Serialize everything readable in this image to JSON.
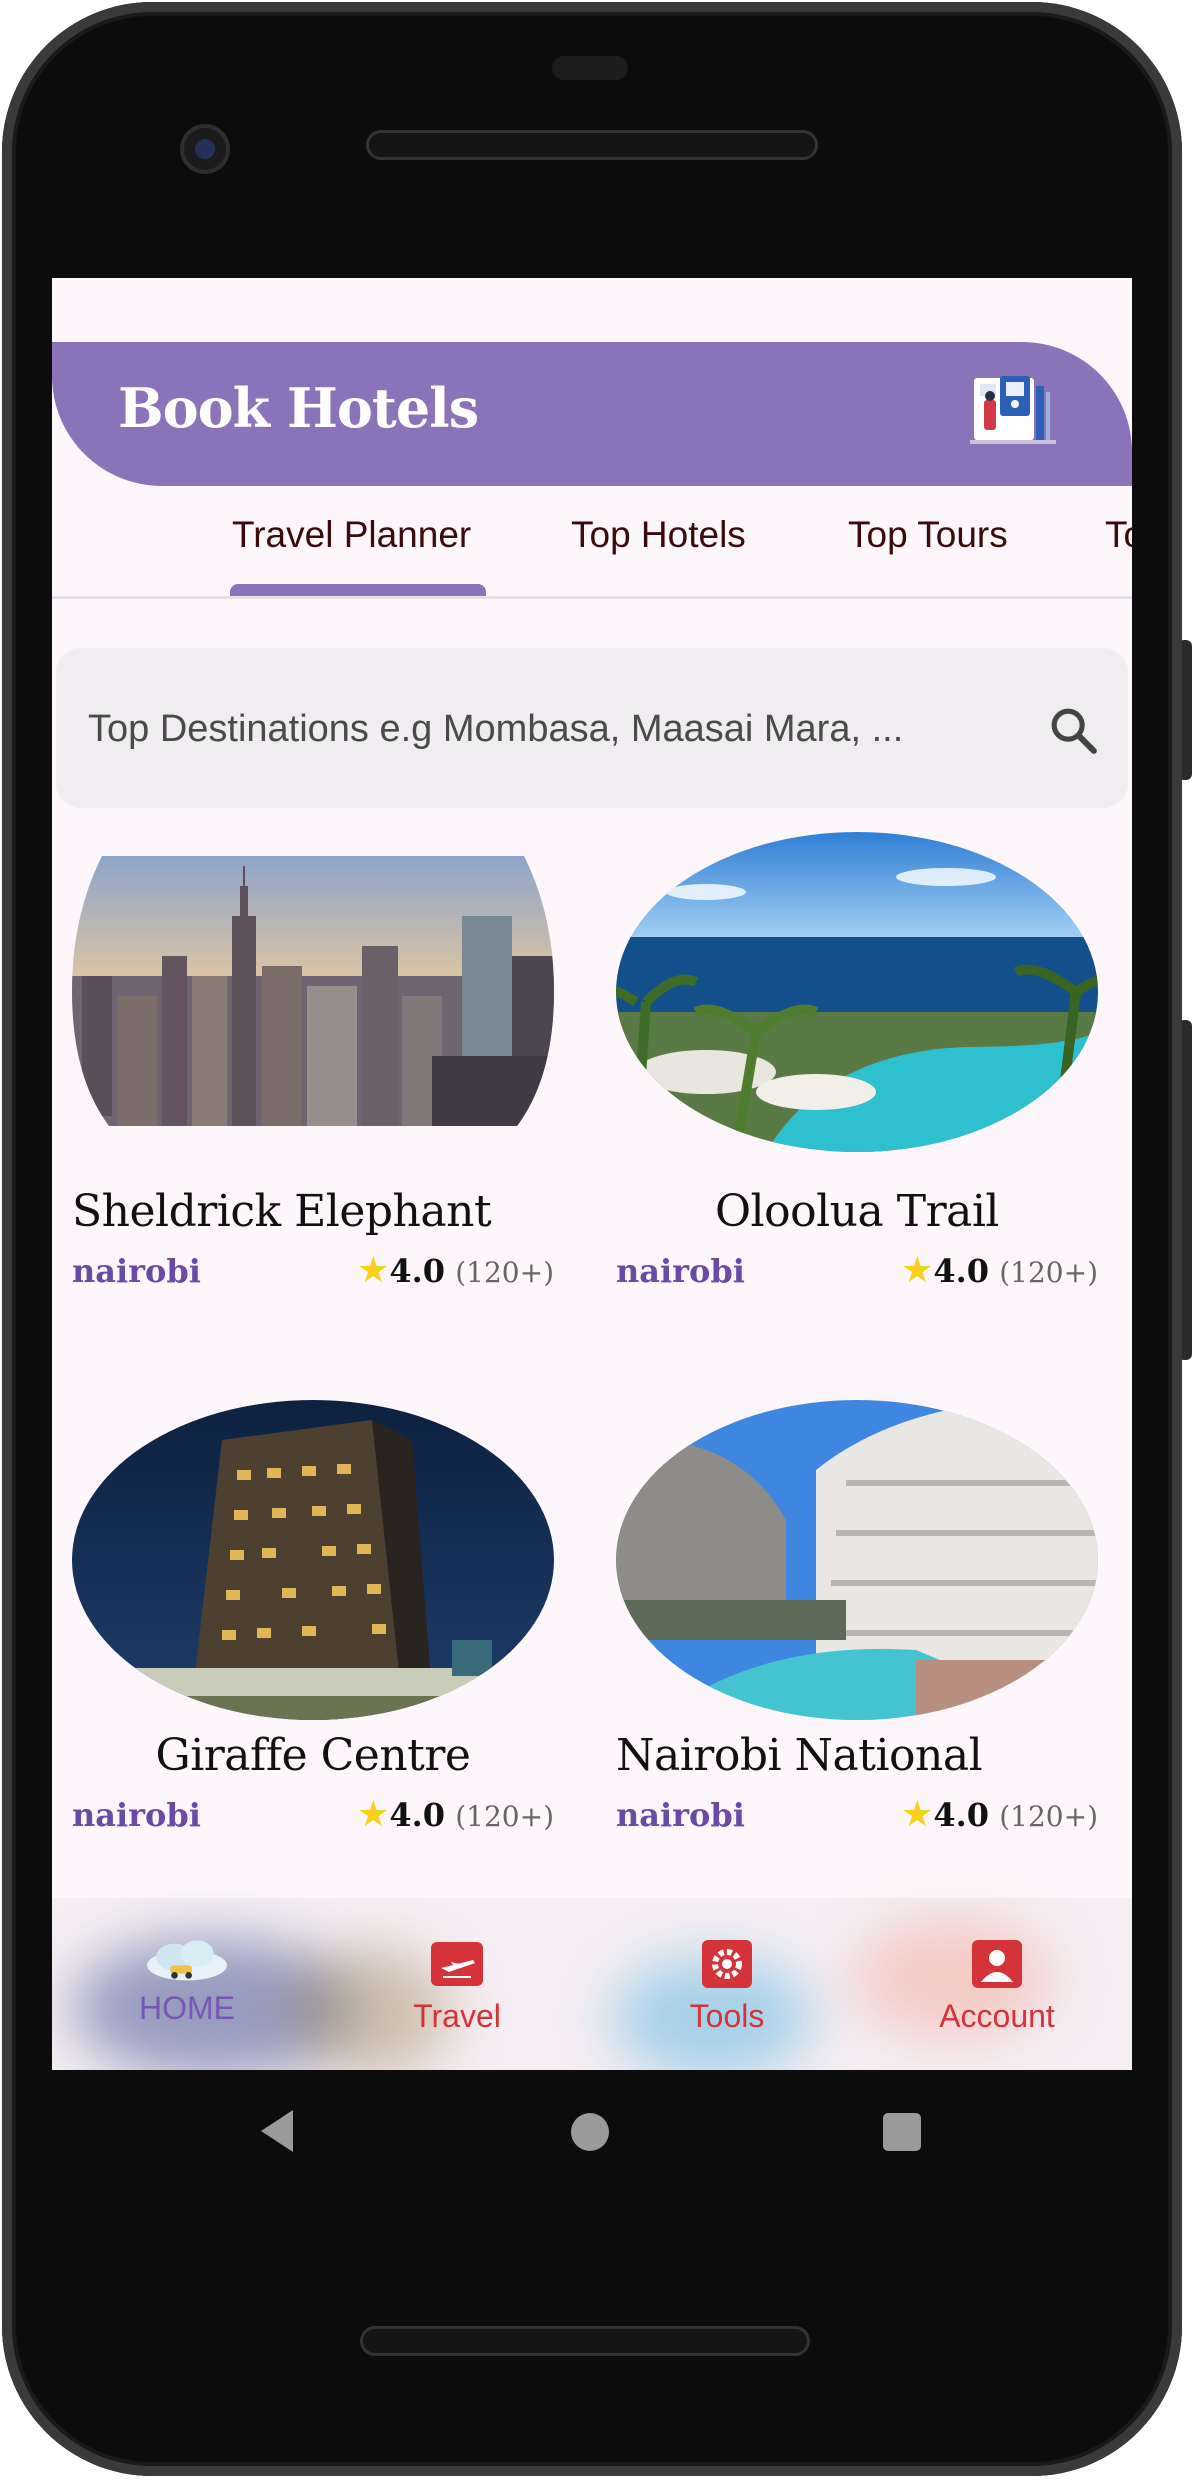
{
  "app": {
    "title": "Book Hotels"
  },
  "tabs": [
    {
      "label": "Travel Planner",
      "active": true
    },
    {
      "label": "Top Hotels",
      "active": false
    },
    {
      "label": "Top Tours",
      "active": false
    },
    {
      "label": "To",
      "active": false
    }
  ],
  "search": {
    "placeholder": "Top Destinations e.g Mombasa, Maasai Mara, ..."
  },
  "cards": [
    {
      "title": "Sheldrick Elephant",
      "location": "nairobi",
      "rating": "4.0",
      "count": "(120+)"
    },
    {
      "title": "Oloolua Trail",
      "location": "nairobi",
      "rating": "4.0",
      "count": "(120+)"
    },
    {
      "title": "Giraffe Centre",
      "location": "nairobi",
      "rating": "4.0",
      "count": "(120+)"
    },
    {
      "title": "Nairobi National",
      "location": "nairobi",
      "rating": "4.0",
      "count": "(120+)"
    }
  ],
  "bottom_nav": [
    {
      "label": "HOME",
      "icon": "home-illustration-icon",
      "active": true
    },
    {
      "label": "Travel",
      "icon": "airplane-icon",
      "active": false
    },
    {
      "label": "Tools",
      "icon": "gear-icon",
      "active": false
    },
    {
      "label": "Account",
      "icon": "account-icon",
      "active": false
    }
  ],
  "colors": {
    "accent": "#8a73b9",
    "location": "#6a4aa6",
    "nav_icon": "#d4333a",
    "star": "#f5d21b"
  }
}
